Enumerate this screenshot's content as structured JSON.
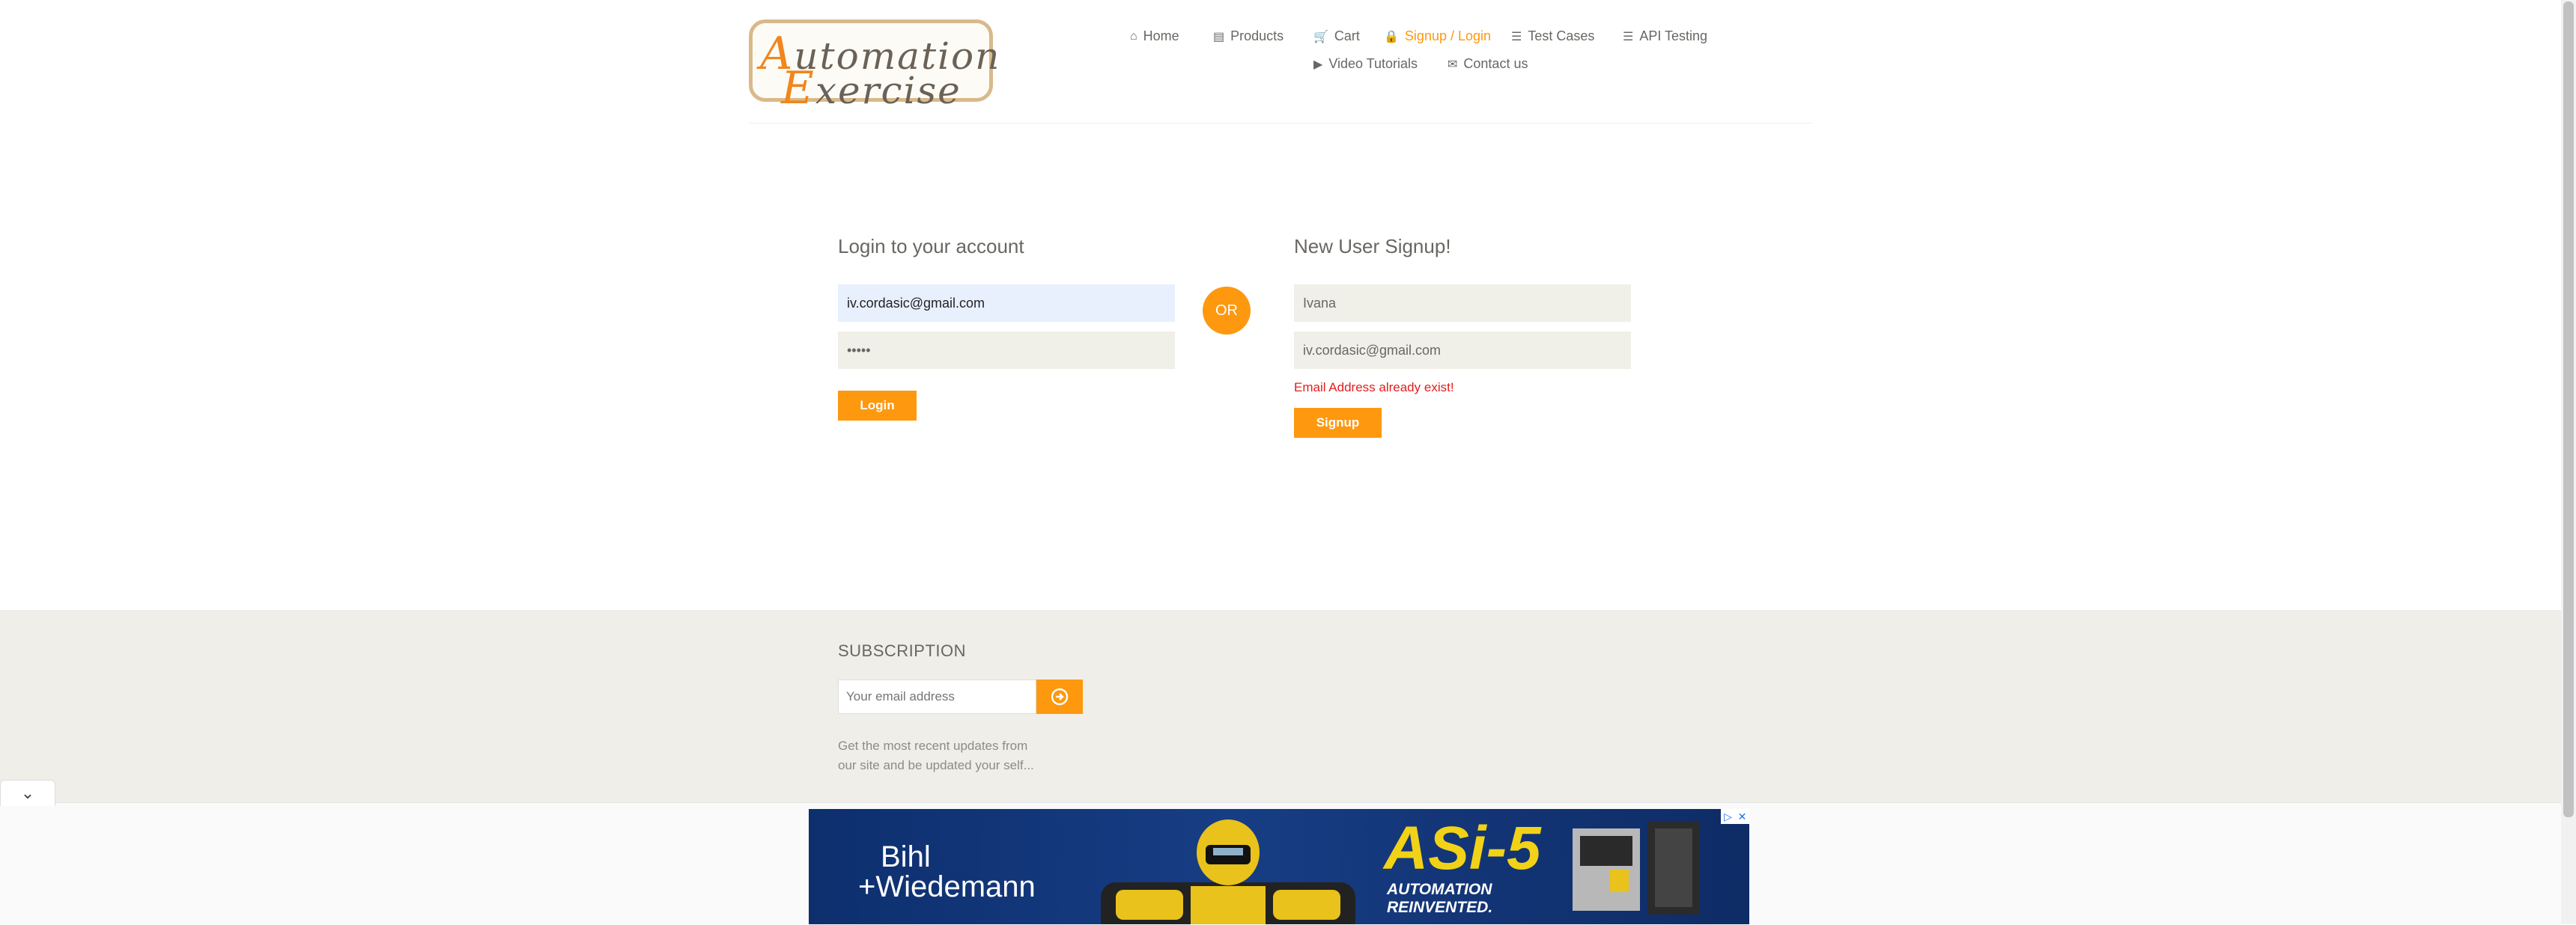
{
  "header": {
    "logo_line1": "Automation",
    "logo_line2": "Exercise",
    "nav": [
      {
        "label": "Home",
        "icon": "home-icon"
      },
      {
        "label": "Products",
        "icon": "products-icon"
      },
      {
        "label": "Cart",
        "icon": "cart-icon"
      },
      {
        "label": "Signup / Login",
        "icon": "lock-icon",
        "active": true
      },
      {
        "label": "Test Cases",
        "icon": "list-icon"
      },
      {
        "label": "API Testing",
        "icon": "list-icon"
      },
      {
        "label": "Video Tutorials",
        "icon": "youtube-icon"
      },
      {
        "label": "Contact us",
        "icon": "envelope-icon"
      }
    ]
  },
  "login": {
    "title": "Login to your account",
    "email_value": "iv.cordasic@gmail.com",
    "password_value": "•••••",
    "button": "Login"
  },
  "or_label": "OR",
  "signup": {
    "title": "New User Signup!",
    "name_value": "Ivana",
    "email_value": "iv.cordasic@gmail.com",
    "error": "Email Address already exist!",
    "button": "Signup"
  },
  "footer": {
    "subscription_title": "SUBSCRIPTION",
    "email_placeholder": "Your email address",
    "description_line1": "Get the most recent updates from",
    "description_line2": "our site and be updated your self..."
  },
  "ad": {
    "brand_line1": "Bihl",
    "brand_line2": "+Wiedemann",
    "headline": "ASi-5",
    "tagline1": "AUTOMATION",
    "tagline2": "REINVENTED."
  },
  "colors": {
    "accent": "#fe980f",
    "error": "#e31d1d"
  }
}
